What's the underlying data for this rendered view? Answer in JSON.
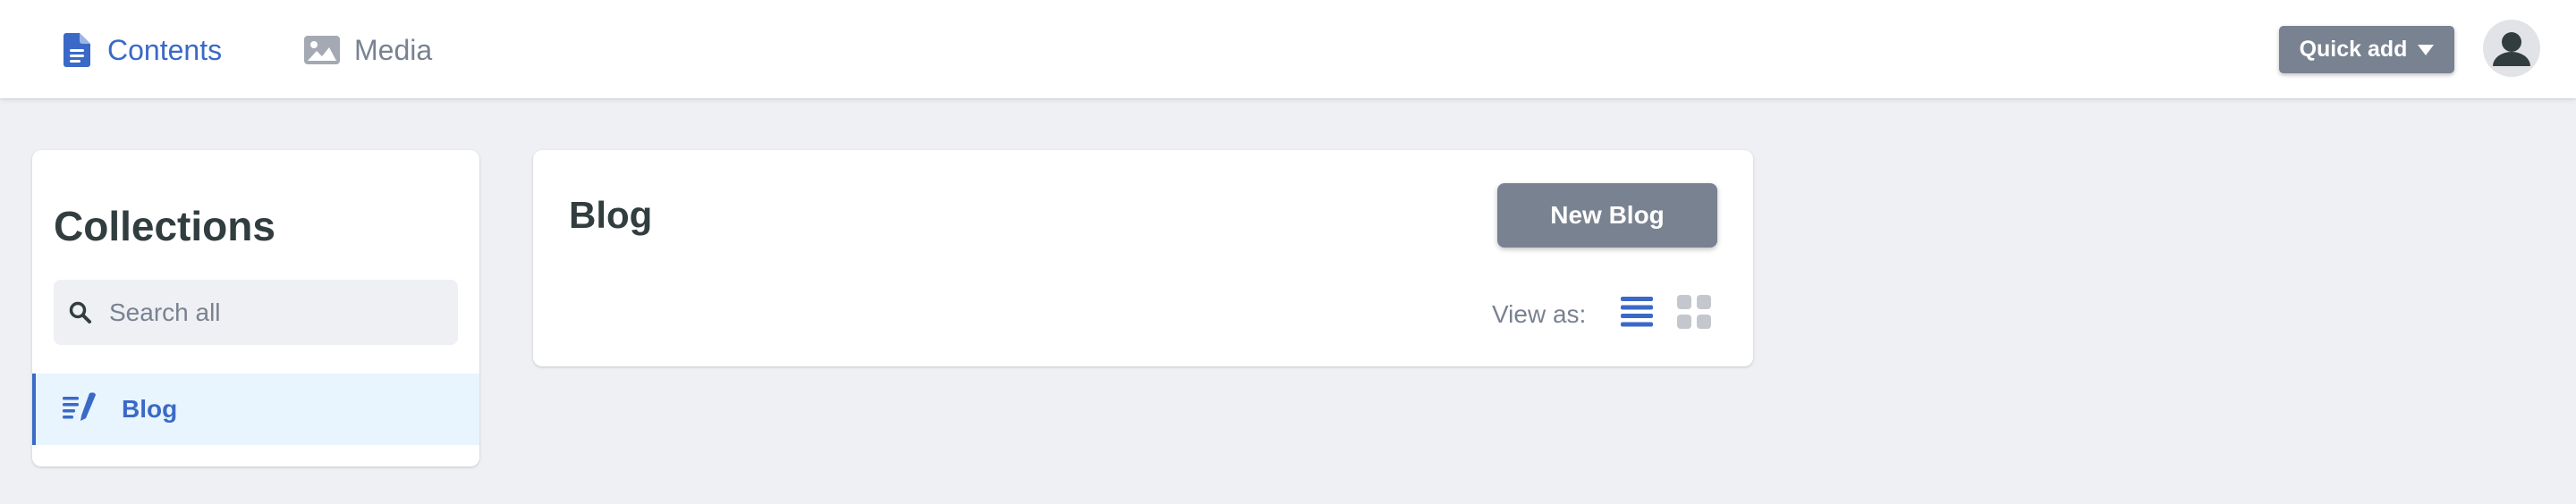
{
  "nav": {
    "contents_label": "Contents",
    "media_label": "Media",
    "quick_add_label": "Quick add"
  },
  "sidebar": {
    "title": "Collections",
    "search_placeholder": "Search all",
    "search_value": "",
    "items": [
      {
        "label": "Blog",
        "icon": "write-icon",
        "active": true
      }
    ]
  },
  "main": {
    "title": "Blog",
    "new_button_label": "New Blog",
    "view_as_label": "View as:",
    "view_modes": [
      {
        "name": "list",
        "icon": "list-icon",
        "active": true
      },
      {
        "name": "grid",
        "icon": "grid-icon",
        "active": false
      }
    ]
  },
  "colors": {
    "accent": "#3a69c7",
    "button_gray": "#798291",
    "background": "#eff0f3",
    "active_item_bg": "#e8f5fe",
    "text_dark": "#313d3e",
    "inactive_icon": "#c4c7ce"
  }
}
